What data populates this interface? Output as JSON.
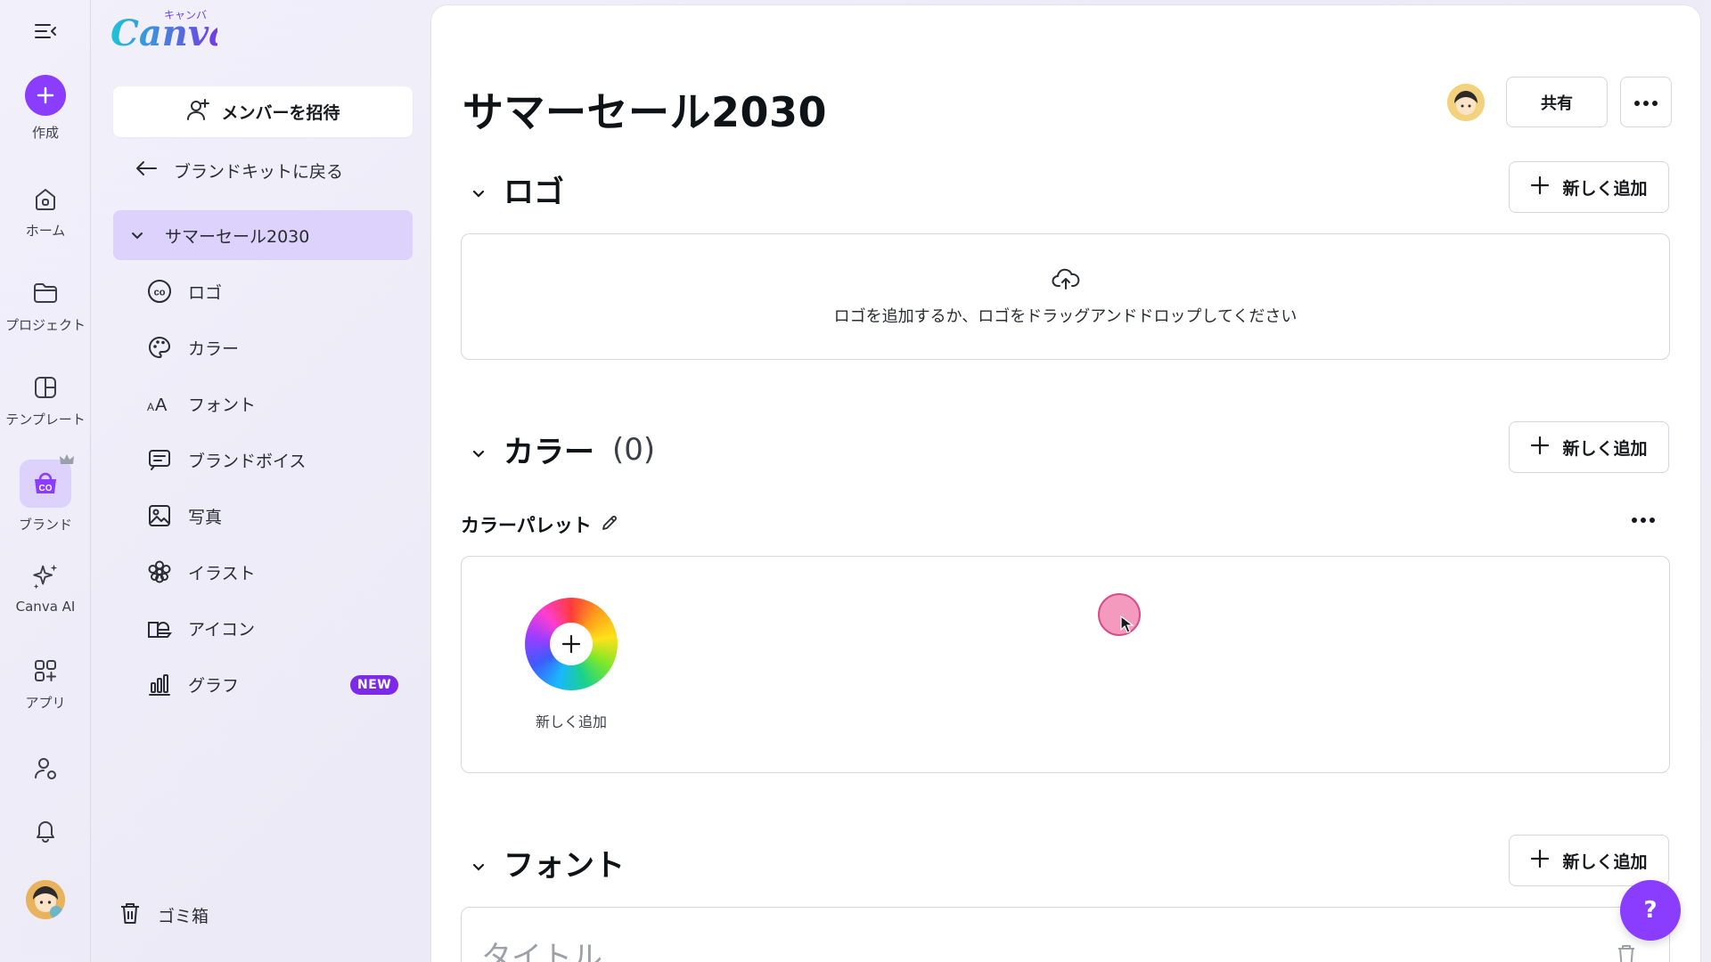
{
  "rail": {
    "create": "作成",
    "home": "ホーム",
    "projects": "プロジェクト",
    "templates": "テンプレート",
    "brand": "ブランド",
    "canva_ai": "Canva AI",
    "apps": "アプリ"
  },
  "logo": {
    "text": "Canva",
    "sub": "キャンバ"
  },
  "panel": {
    "invite": "メンバーを招待",
    "back": "ブランドキットに戻る",
    "kit": "サマーセール2030",
    "items": [
      "ロゴ",
      "カラー",
      "フォント",
      "ブランドボイス",
      "写真",
      "イラスト",
      "アイコン",
      "グラフ"
    ],
    "new_badge": "NEW",
    "trash": "ゴミ箱"
  },
  "main": {
    "title": "サマーセール2030",
    "share": "共有",
    "add_new": "新しく追加",
    "logo_section": {
      "title": "ロゴ",
      "dropzone": "ロゴを追加するか、ロゴをドラッグアンドドロップしてください"
    },
    "color_section": {
      "title": "カラー",
      "count": "(0)",
      "palette_label": "カラーパレット",
      "swatch_add": "新しく追加"
    },
    "font_section": {
      "title": "フォント",
      "row_placeholder": "タイトル"
    }
  },
  "help": "?",
  "colors": {
    "accent": "#8b3dff",
    "selected_bg": "#ddd2fb",
    "badge": "#7d2ae8"
  }
}
